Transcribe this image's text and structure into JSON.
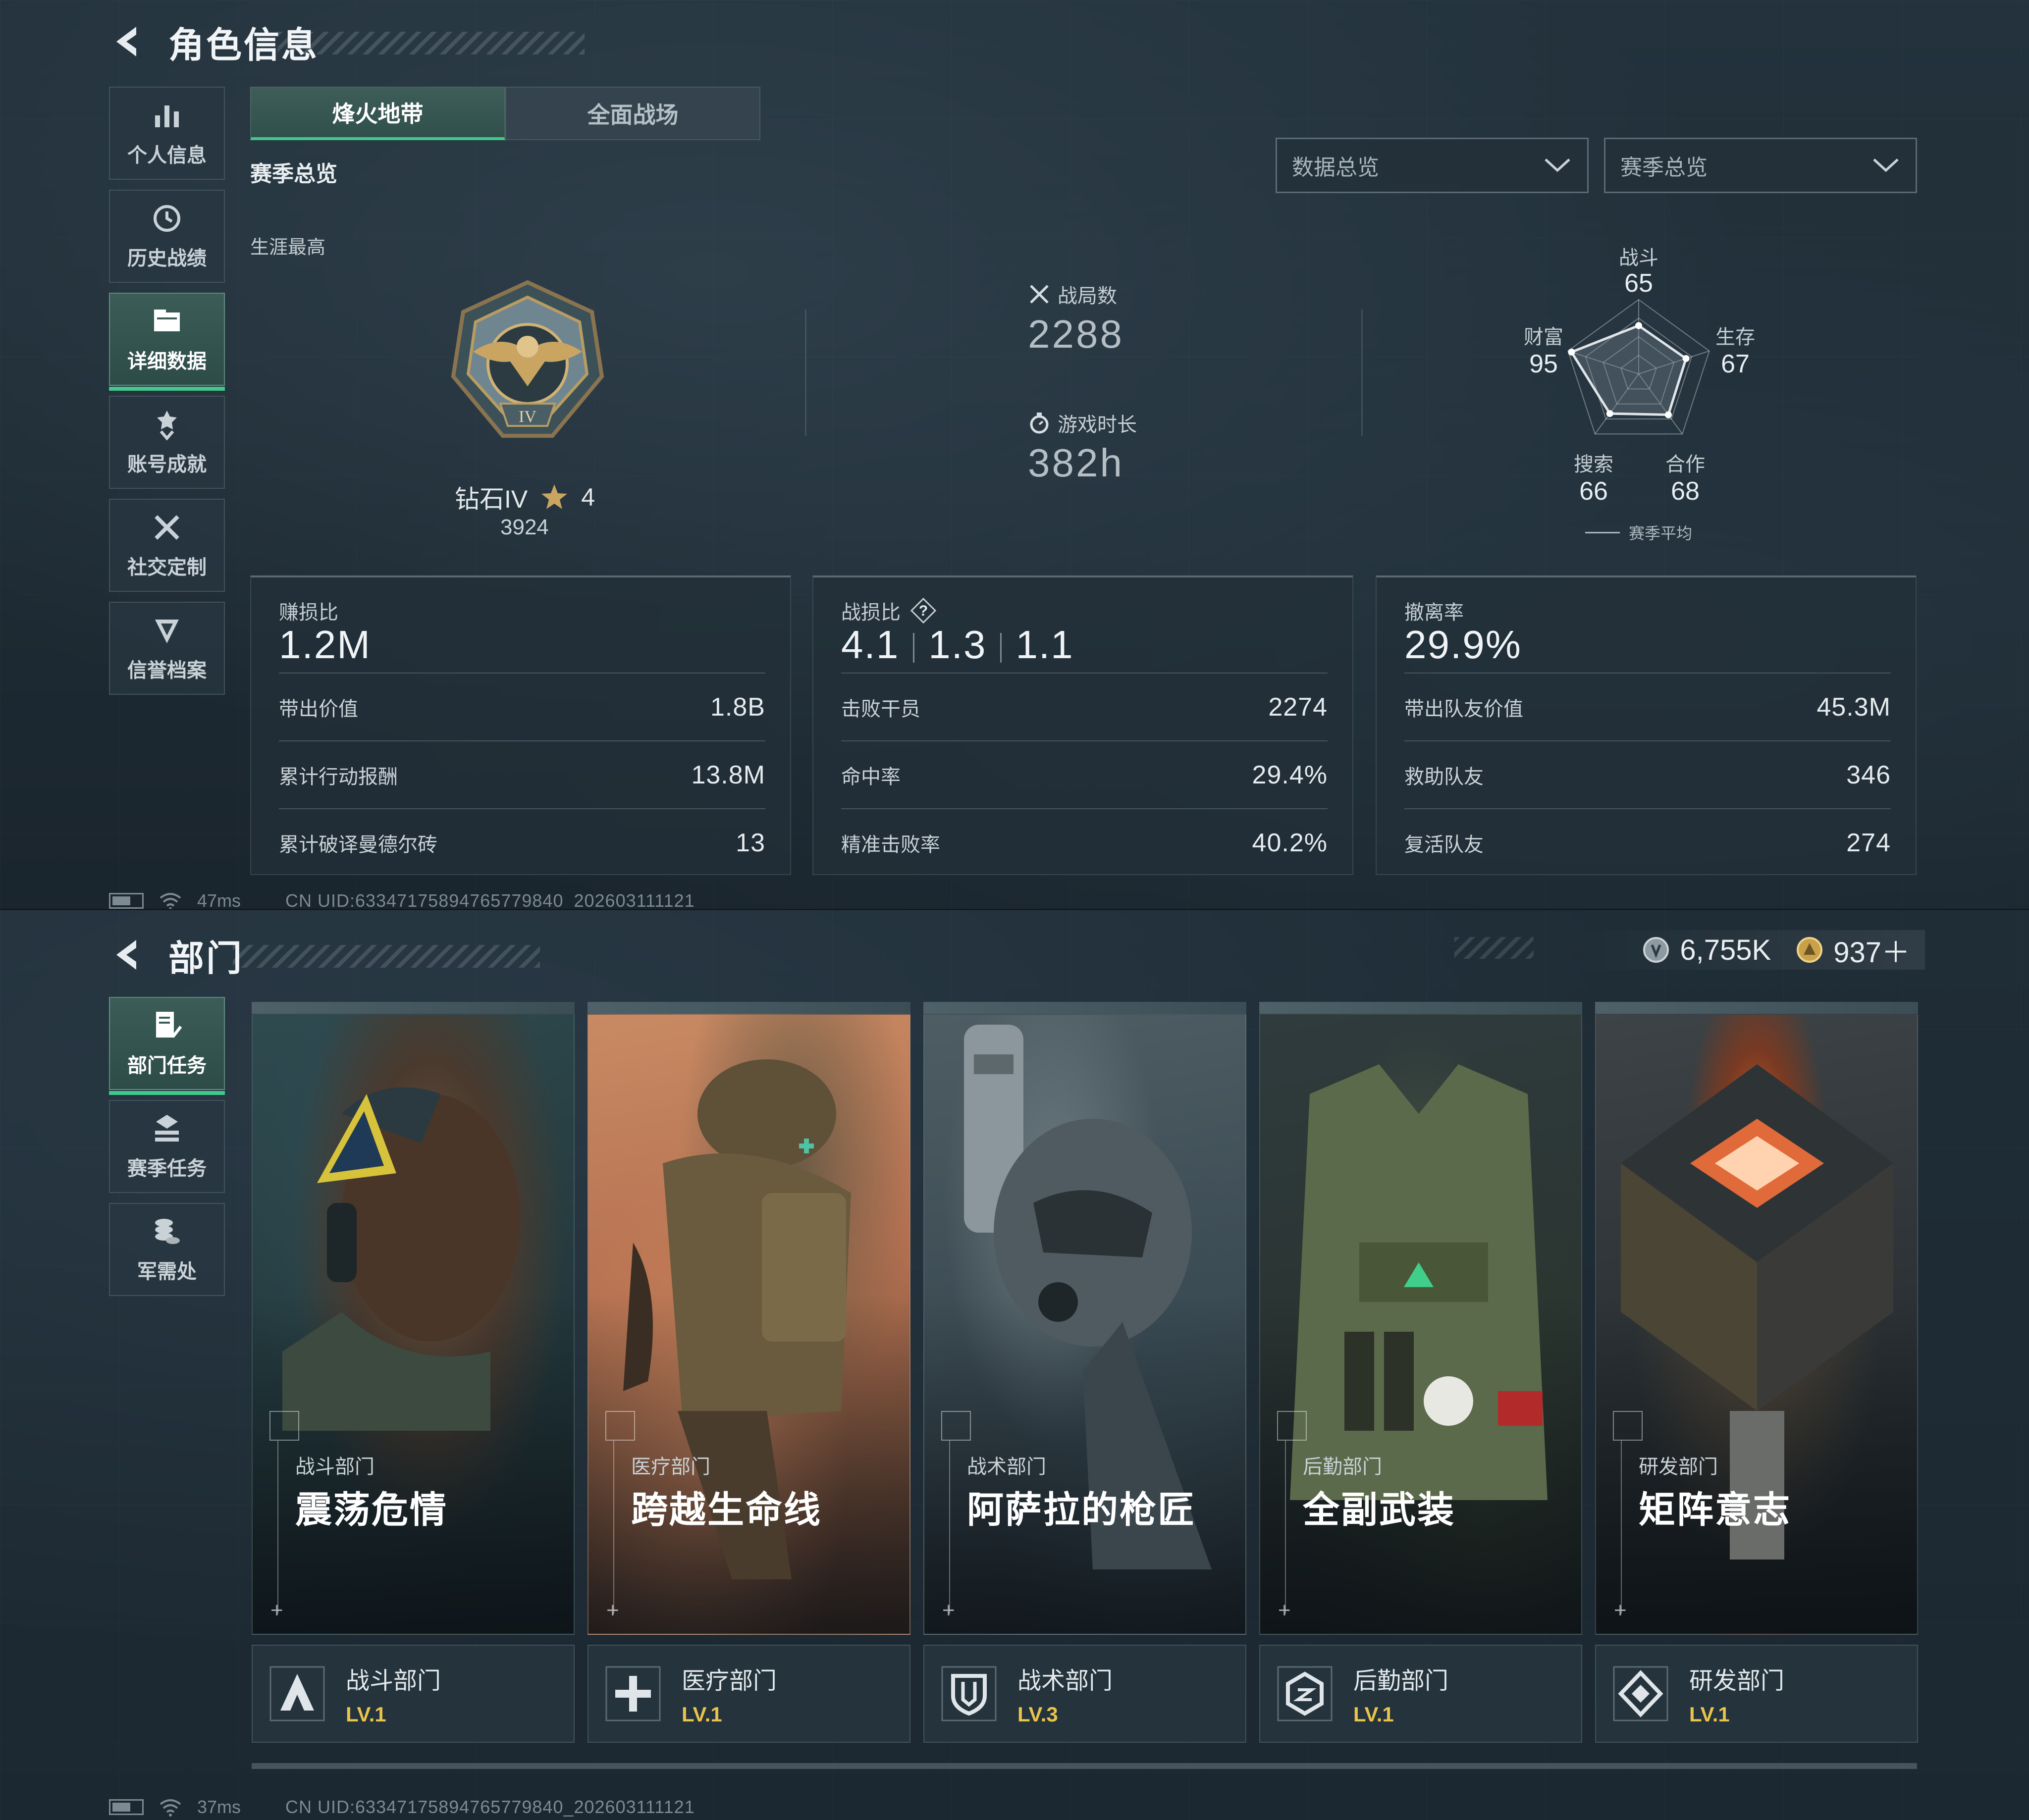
{
  "top": {
    "header": {
      "title": "角色信息"
    },
    "sidebar": [
      {
        "label": "个人信息",
        "icon": "bar-chart-icon",
        "active": false
      },
      {
        "label": "历史战绩",
        "icon": "history-icon",
        "active": false
      },
      {
        "label": "详细数据",
        "icon": "folder-icon",
        "active": true
      },
      {
        "label": "账号成就",
        "icon": "achievement-icon",
        "active": false
      },
      {
        "label": "社交定制",
        "icon": "tools-icon",
        "active": false
      },
      {
        "label": "信誉档案",
        "icon": "credit-shield-icon",
        "active": false
      }
    ],
    "tabs": [
      {
        "label": "烽火地带",
        "active": true
      },
      {
        "label": "全面战场",
        "active": false
      }
    ],
    "section_title": "赛季总览",
    "dropdowns": [
      {
        "value": "数据总览"
      },
      {
        "value": "赛季总览"
      }
    ],
    "career_best_label": "生涯最高",
    "rank": {
      "name": "钻石IV",
      "stars": "4",
      "score": "3924",
      "emblem_numeral": "IV"
    },
    "matches": {
      "label": "战局数",
      "value": "2288"
    },
    "playtime": {
      "label": "游戏时长",
      "value": "382h"
    },
    "radar": {
      "axes": [
        {
          "label": "战斗",
          "value": "65",
          "score": 65
        },
        {
          "label": "生存",
          "value": "67",
          "score": 67
        },
        {
          "label": "合作",
          "value": "68",
          "score": 68
        },
        {
          "label": "搜索",
          "value": "66",
          "score": 66
        },
        {
          "label": "财富",
          "value": "95",
          "score": 95
        }
      ],
      "legend": "赛季平均"
    },
    "cards": [
      {
        "head_label": "赚损比",
        "head_value": "1.2M",
        "rows": [
          {
            "k": "带出价值",
            "v": "1.8B"
          },
          {
            "k": "累计行动报酬",
            "v": "13.8M"
          },
          {
            "k": "累计破译曼德尔砖",
            "v": "13"
          }
        ]
      },
      {
        "head_label": "战损比",
        "head_values": [
          "4.1",
          "1.3",
          "1.1"
        ],
        "rows": [
          {
            "k": "击败干员",
            "v": "2274"
          },
          {
            "k": "命中率",
            "v": "29.4%"
          },
          {
            "k": "精准击败率",
            "v": "40.2%"
          }
        ]
      },
      {
        "head_label": "撤离率",
        "head_value": "29.9%",
        "rows": [
          {
            "k": "带出队友价值",
            "v": "45.3M"
          },
          {
            "k": "救助队友",
            "v": "346"
          },
          {
            "k": "复活队友",
            "v": "274"
          }
        ]
      }
    ],
    "status": {
      "ping": "47ms",
      "uid": "CN UID:63347175894765779840_202603111121"
    }
  },
  "bottom": {
    "header": {
      "title": "部门"
    },
    "currency": {
      "coins": "6,755K",
      "tokens": "937＋"
    },
    "sidebar": [
      {
        "label": "部门任务",
        "icon": "task-doc-icon",
        "active": true
      },
      {
        "label": "赛季任务",
        "icon": "season-task-icon",
        "active": false
      },
      {
        "label": "军需处",
        "icon": "supply-coins-icon",
        "active": false
      }
    ],
    "departments": [
      {
        "category": "战斗部门",
        "name": "震荡危情",
        "foot_name": "战斗部门",
        "level": "LV.1",
        "icon": "combat-dept-icon"
      },
      {
        "category": "医疗部门",
        "name": "跨越生命线",
        "foot_name": "医疗部门",
        "level": "LV.1",
        "icon": "medical-dept-icon"
      },
      {
        "category": "战术部门",
        "name": "阿萨拉的枪匠",
        "foot_name": "战术部门",
        "level": "LV.3",
        "icon": "tactical-dept-icon"
      },
      {
        "category": "后勤部门",
        "name": "全副武装",
        "foot_name": "后勤部门",
        "level": "LV.1",
        "icon": "logistics-dept-icon"
      },
      {
        "category": "研发部门",
        "name": "矩阵意志",
        "foot_name": "研发部门",
        "level": "LV.1",
        "icon": "research-dept-icon"
      }
    ],
    "status": {
      "ping": "37ms",
      "uid": "CN UID:63347175894765779840_202603111121"
    }
  },
  "colors": {
    "accent_green": "#40c98b",
    "level_gold": "#e9c44a",
    "panel_bg": "#1e2b34"
  }
}
